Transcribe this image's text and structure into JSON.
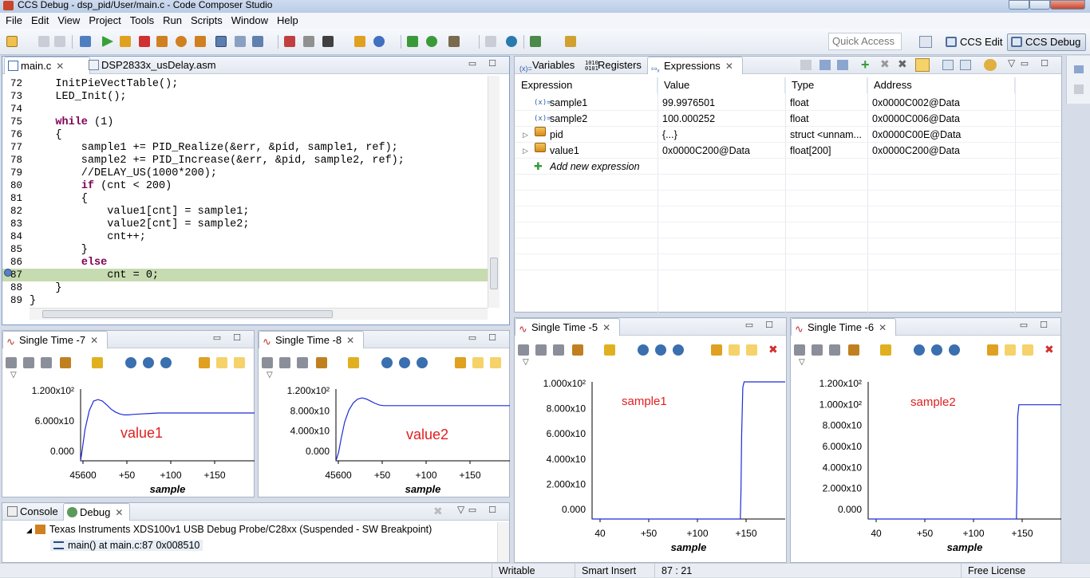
{
  "window": {
    "title": "CCS Debug - dsp_pid/User/main.c - Code Composer Studio"
  },
  "menu": [
    "File",
    "Edit",
    "View",
    "Project",
    "Tools",
    "Run",
    "Scripts",
    "Window",
    "Help"
  ],
  "toolbar": {
    "quick_access_placeholder": "Quick Access",
    "perspectives": [
      {
        "label": "CCS Edit",
        "active": false
      },
      {
        "label": "CCS Debug",
        "active": true
      }
    ]
  },
  "editor": {
    "tabs": [
      {
        "label": "main.c",
        "selected": true
      },
      {
        "label": "DSP2833x_usDelay.asm",
        "selected": false
      }
    ],
    "lines": [
      {
        "num": "72",
        "text": "    InitPieVectTable();"
      },
      {
        "num": "73",
        "text": "    LED_Init();"
      },
      {
        "num": "74",
        "text": ""
      },
      {
        "num": "75",
        "text": "    while (1)"
      },
      {
        "num": "76",
        "text": "    {"
      },
      {
        "num": "77",
        "text": "        sample1 += PID_Realize(&err, &pid, sample1, ref);"
      },
      {
        "num": "78",
        "text": "        sample2 += PID_Increase(&err, &pid, sample2, ref);"
      },
      {
        "num": "79",
        "text": "        //DELAY_US(1000*200);"
      },
      {
        "num": "80",
        "text": "        if (cnt < 200)"
      },
      {
        "num": "81",
        "text": "        {"
      },
      {
        "num": "82",
        "text": "            value1[cnt] = sample1;"
      },
      {
        "num": "83",
        "text": "            value2[cnt] = sample2;"
      },
      {
        "num": "84",
        "text": "            cnt++;"
      },
      {
        "num": "85",
        "text": "        }"
      },
      {
        "num": "86",
        "text": "        else"
      },
      {
        "num": "87",
        "text": "            cnt = 0;"
      },
      {
        "num": "88",
        "text": "    }"
      },
      {
        "num": "89",
        "text": "}"
      }
    ],
    "current_line": "87"
  },
  "expressions_view": {
    "tabs": [
      "Variables",
      "Registers",
      "Expressions"
    ],
    "selected_tab": "Expressions",
    "columns": [
      "Expression",
      "Value",
      "Type",
      "Address"
    ],
    "rows": [
      {
        "expression": "sample1",
        "value": "99.9976501",
        "type": "float",
        "address": "0x0000C002@Data",
        "icon": "variable-icon"
      },
      {
        "expression": "sample2",
        "value": "100.000252",
        "type": "float",
        "address": "0x0000C006@Data",
        "icon": "variable-icon"
      },
      {
        "expression": "pid",
        "value": "{...}",
        "type": "struct <unnam...",
        "address": "0x0000C00E@Data",
        "icon": "struct-icon"
      },
      {
        "expression": "value1",
        "value": "0x0000C200@Data",
        "type": "float[200]",
        "address": "0x0000C200@Data",
        "icon": "array-icon"
      }
    ],
    "add_new": "Add new expression"
  },
  "graph_views": [
    {
      "tab": "Single Time -7",
      "label": "value1"
    },
    {
      "tab": "Single Time -8",
      "label": "value2"
    },
    {
      "tab": "Single Time -5",
      "label": "sample1"
    },
    {
      "tab": "Single Time -6",
      "label": "sample2"
    }
  ],
  "chart_data": [
    {
      "type": "line",
      "series_label": "value1",
      "xlabel": "sample",
      "ticks_y": [
        "1.200x10²",
        "6.000x10",
        "0.000"
      ],
      "ticks_x": [
        "45600",
        "+50",
        "+100",
        "+150"
      ],
      "ylim": [
        0,
        150
      ],
      "xlim": [
        0,
        200
      ],
      "x": [
        0,
        2,
        5,
        10,
        15,
        20,
        25,
        30,
        35,
        40,
        45,
        50,
        55,
        60,
        70,
        80,
        90,
        100,
        120,
        140,
        160,
        180,
        200
      ],
      "y": [
        0,
        25,
        65,
        105,
        125,
        128,
        125,
        117,
        108,
        102,
        98,
        96,
        96,
        97,
        98,
        99,
        100,
        100,
        100,
        100,
        100,
        100,
        100
      ]
    },
    {
      "type": "line",
      "series_label": "value2",
      "xlabel": "sample",
      "ticks_y": [
        "1.200x10²",
        "8.000x10",
        "4.000x10",
        "0.000"
      ],
      "ticks_x": [
        "45600",
        "+50",
        "+100",
        "+150"
      ],
      "ylim": [
        0,
        130
      ],
      "xlim": [
        0,
        200
      ],
      "x": [
        0,
        3,
        6,
        10,
        15,
        20,
        25,
        30,
        35,
        40,
        45,
        50,
        55,
        60,
        70,
        80,
        90,
        100,
        120,
        140,
        160,
        180,
        200
      ],
      "y": [
        0,
        15,
        40,
        70,
        92,
        105,
        112,
        114,
        112,
        108,
        104,
        101,
        100,
        100,
        100,
        100,
        100,
        100,
        100,
        100,
        100,
        100,
        100
      ]
    },
    {
      "type": "line",
      "series_label": "sample1",
      "xlabel": "sample",
      "ticks_y": [
        "1.000x10²",
        "8.000x10",
        "6.000x10",
        "4.000x10",
        "2.000x10",
        "0.000"
      ],
      "ticks_x": [
        "40",
        "+50",
        "+100",
        "+150"
      ],
      "ylim": [
        0,
        100
      ],
      "xlim": [
        40,
        195
      ],
      "x": [
        40,
        60,
        80,
        100,
        120,
        140,
        159,
        159.5,
        160,
        161,
        162,
        163,
        170,
        180,
        195
      ],
      "y": [
        0,
        0,
        0,
        0,
        0,
        0,
        0,
        20,
        60,
        96,
        100,
        100,
        100,
        100,
        100
      ]
    },
    {
      "type": "line",
      "series_label": "sample2",
      "xlabel": "sample",
      "ticks_y": [
        "1.200x10²",
        "1.000x10²",
        "8.000x10",
        "6.000x10",
        "4.000x10",
        "2.000x10",
        "0.000"
      ],
      "ticks_x": [
        "40",
        "+50",
        "+100",
        "+150"
      ],
      "ylim": [
        0,
        120
      ],
      "xlim": [
        40,
        195
      ],
      "x": [
        40,
        60,
        80,
        100,
        120,
        140,
        159,
        159.5,
        160,
        161,
        162,
        170,
        180,
        195
      ],
      "y": [
        0,
        0,
        0,
        0,
        0,
        0,
        0,
        30,
        90,
        100,
        100,
        100,
        100,
        100
      ]
    }
  ],
  "console_view": {
    "tabs": [
      "Console",
      "Debug"
    ],
    "items": [
      "Texas Instruments XDS100v1 USB Debug Probe/C28xx (Suspended - SW Breakpoint)",
      "main() at main.c:87 0x008510"
    ]
  },
  "statusbar": {
    "mode": "Writable",
    "insert": "Smart Insert",
    "position": "87 : 21",
    "license": "Free License"
  }
}
